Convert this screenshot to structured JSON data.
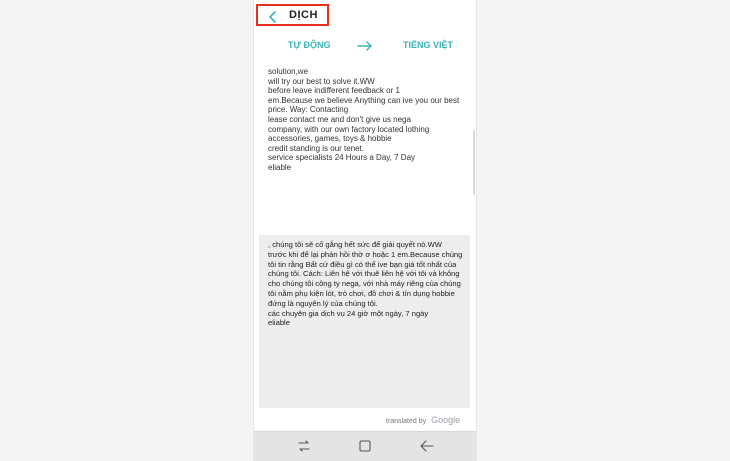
{
  "header": {
    "title": "DỊCH"
  },
  "languages": {
    "source": "TỰ ĐỘNG",
    "target": "TIẾNG VIỆT"
  },
  "source_text": "solution,we\nwill try our best to solve it.WW\nbefore leave indifferent feedback or 1\nem.Because we believe Anything can ive you our best price. Way: Contacting\nlease contact me and don't give us nega\ncompany, with our own factory located lothing\naccessories, games, toys & hobbie\ncredit standing is our tenet.\nservice specialists 24 Hours a Day, 7 Day\neliable",
  "translation_text": ", chúng tôi sẽ cố gắng hết sức để giải quyết nó.WW\ntrước khi để lại phản hồi thờ ơ hoặc 1 em.Because chúng tôi tin rằng Bất cứ điều gì có thể ive bạn giá tốt nhất của chúng tôi. Cách: Liên hệ với thuê liên hệ với tôi và không cho chúng tôi công ty nega, với nhà máy riêng của chúng tôi nằm phụ kiện lót, trò chơi, đồ chơi & tín dụng hobbie đứng là nguyên lý của chúng tôi.\ncác chuyên gia dịch vụ 24 giờ một ngày, 7 ngày\neliable",
  "credit": {
    "label": "translated by",
    "brand": "Google"
  },
  "colors": {
    "accent": "#3ab3b9",
    "highlight_border": "#e8301e"
  },
  "icons": {
    "back": "chevron-left-icon",
    "swap": "arrow-right-icon",
    "recents": "recent-apps-icon",
    "home": "home-icon",
    "nav_back": "back-arrow-icon"
  }
}
